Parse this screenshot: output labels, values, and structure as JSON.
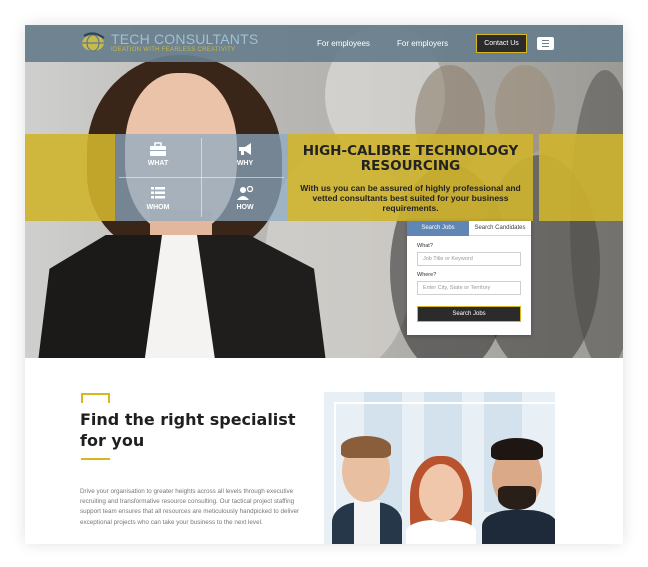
{
  "header": {
    "brand_title": "TECH CONSULTANTS",
    "brand_tagline": "IDEATION WITH FEARLESS CREATIVITY",
    "nav": {
      "employees": "For employees",
      "employers": "For employers"
    },
    "contact_label": "Contact Us",
    "menu_icon": "hamburger-icon"
  },
  "hero": {
    "title": "HIGH-CALIBRE TECHNOLOGY RESOURCING",
    "subtitle": "With us you can be assured of highly professional and vetted consultants best suited for your business requirements.",
    "grid": [
      {
        "label": "WHAT",
        "icon": "briefcase-icon"
      },
      {
        "label": "WHY",
        "icon": "megaphone-icon"
      },
      {
        "label": "WHOM",
        "icon": "list-icon"
      },
      {
        "label": "HOW",
        "icon": "person-gear-icon"
      }
    ]
  },
  "search": {
    "tabs": [
      "Search Jobs",
      "Search Candidates"
    ],
    "what_label": "What?",
    "what_placeholder": "Job Title or Keyword",
    "where_label": "Where?",
    "where_placeholder": "Enter City, State or Territory",
    "button_label": "Search Jobs"
  },
  "section": {
    "title": "Find the right specialist for you",
    "body": "Drive your organisation to greater heights across all levels through executive recruiting and transformative resource consulting. Our tactical project staffing support team ensures that all resources are meticulously handpicked to deliver exceptional projects who can take your business to the next level."
  },
  "colors": {
    "header_bg": "#677d8c",
    "accent_yellow": "#d6b622",
    "tile_blue": "#8caac4",
    "tab_blue": "#5f86b4",
    "dark_button": "#2b2b2b"
  }
}
